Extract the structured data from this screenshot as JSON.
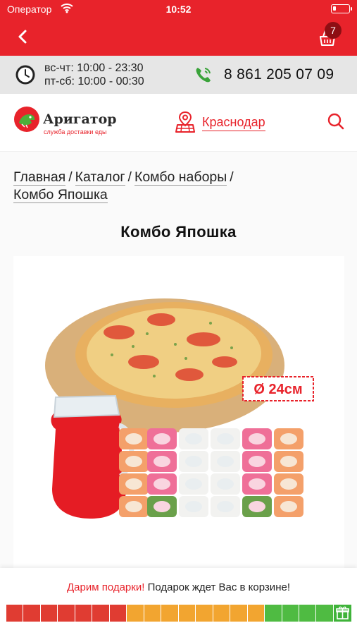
{
  "status_bar": {
    "carrier": "Оператор",
    "time": "10:52"
  },
  "nav": {
    "cart_count": "7"
  },
  "info_bar": {
    "hours_weekdays": "вс-чт: 10:00 - 23:30",
    "hours_weekend": "пт-сб: 10:00 - 00:30",
    "phone": "8 861 205 07 09"
  },
  "header": {
    "logo_title": "Аригатор",
    "logo_subtitle": "служба доставки еды",
    "city": "Краснодар"
  },
  "breadcrumbs": {
    "home": "Главная",
    "catalog": "Каталог",
    "category": "Комбо наборы",
    "current": "Комбо Япошка",
    "separator": "/"
  },
  "product": {
    "title": "Комбо Япошка",
    "size_badge": "Ø 24см"
  },
  "promo": {
    "highlight": "Дарим подарки!",
    "text": "Подарок ждет Вас в корзине!",
    "progress_segments": 20,
    "progress_filled_red": 7,
    "progress_filled_orange": 8,
    "progress_filled_green": 5
  },
  "colors": {
    "brand_red": "#e8232b",
    "progress_red": "#e03c32",
    "progress_orange": "#f2a530",
    "progress_green": "#4fbb42"
  }
}
